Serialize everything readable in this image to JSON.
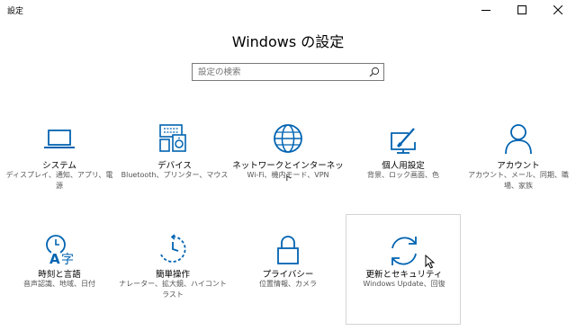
{
  "window": {
    "title": "設定"
  },
  "page": {
    "title": "Windows の設定"
  },
  "search": {
    "placeholder": "設定の検索"
  },
  "tiles": [
    {
      "label": "システム",
      "description": "ディスプレイ、通知、アプリ、電源",
      "icon": "laptop-icon"
    },
    {
      "label": "デバイス",
      "description": "Bluetooth、プリンター、マウス",
      "icon": "devices-icon"
    },
    {
      "label": "ネットワークとインターネット",
      "description": "Wi-Fi、機内モード、VPN",
      "icon": "globe-icon"
    },
    {
      "label": "個人用設定",
      "description": "背景、ロック画面、色",
      "icon": "personalization-icon"
    },
    {
      "label": "アカウント",
      "description": "アカウント、メール、同期、職場、家族",
      "icon": "person-icon"
    },
    {
      "label": "時刻と言語",
      "description": "音声認識、地域、日付",
      "icon": "time-language-icon"
    },
    {
      "label": "簡単操作",
      "description": "ナレーター、拡大鏡、ハイコントラスト",
      "icon": "ease-of-access-icon"
    },
    {
      "label": "プライバシー",
      "description": "位置情報、カメラ",
      "icon": "lock-icon"
    },
    {
      "label": "更新とセキュリティ",
      "description": "Windows Update、回復",
      "icon": "sync-icon"
    }
  ],
  "colors": {
    "accent": "#0063b1",
    "text": "#000000",
    "subtext": "#555555"
  }
}
